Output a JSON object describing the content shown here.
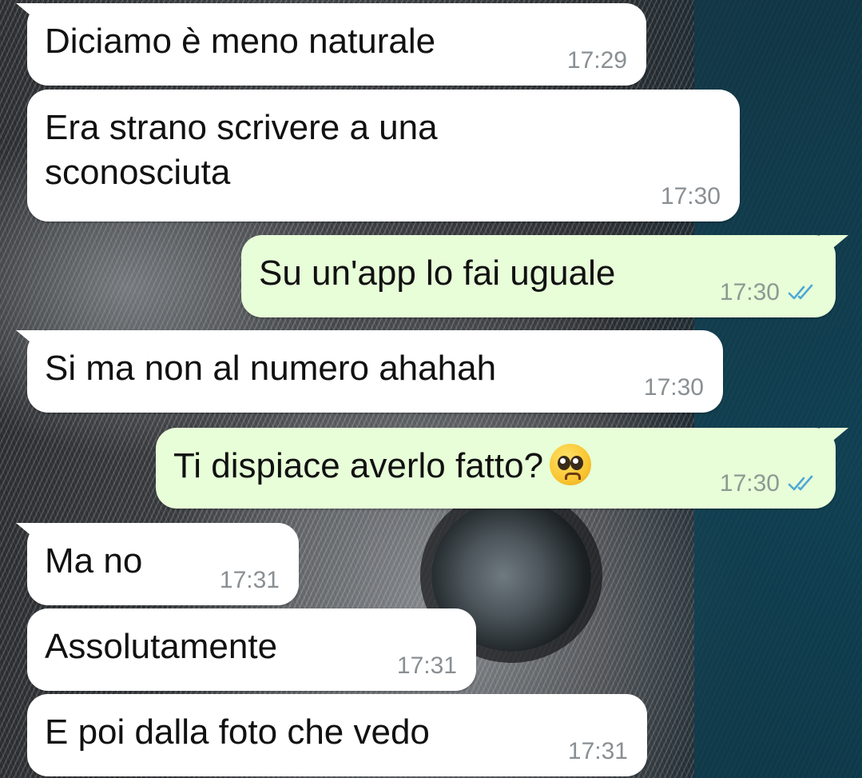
{
  "colors": {
    "incoming_bubble": "#ffffff",
    "outgoing_bubble": "#e7fed8",
    "read_ticks": "#4fa8d6",
    "timestamp": "#8a8f93"
  },
  "messages": [
    {
      "direction": "incoming",
      "text": "Diciamo è meno naturale",
      "time": "17:29"
    },
    {
      "direction": "incoming",
      "text": "Era strano scrivere a una\nsconosciuta",
      "time": "17:30"
    },
    {
      "direction": "outgoing",
      "text": "Su un'app lo fai uguale",
      "time": "17:30",
      "status_icon": "double-check-read-icon"
    },
    {
      "direction": "incoming",
      "text": "Si ma non al numero ahahah",
      "time": "17:30"
    },
    {
      "direction": "outgoing",
      "text": "Ti dispiace averlo fatto?",
      "emoji": "pleading-face-emoji",
      "time": "17:30",
      "status_icon": "double-check-read-icon"
    },
    {
      "direction": "incoming",
      "text": "Ma no",
      "time": "17:31"
    },
    {
      "direction": "incoming",
      "text": "Assolutamente",
      "time": "17:31"
    },
    {
      "direction": "incoming",
      "text": "E poi dalla foto che vedo",
      "time": "17:31"
    }
  ]
}
